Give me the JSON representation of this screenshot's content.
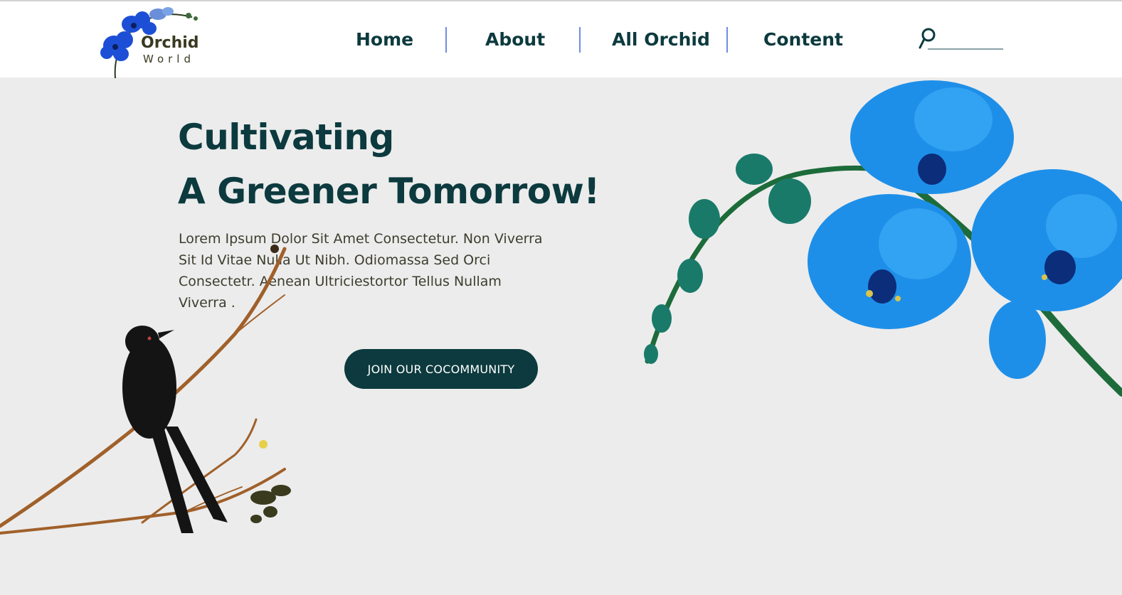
{
  "logo": {
    "title": "Orchid",
    "subtitle": "World"
  },
  "nav": {
    "items": [
      "Home",
      "About",
      "All Orchid",
      "Content"
    ]
  },
  "search": {
    "icon": "search-icon",
    "placeholder": ""
  },
  "hero": {
    "title_line1": "Cultivating",
    "title_line2": "A Greener Tomorrow!",
    "text_lines": [
      "Lorem Ipsum Dolor Sit Amet Consectetur. Non Viverra",
      "Sit Id Vitae        Nulla Ut Nibh. Odiomassa Sed Orci",
      "Consectetr.    Aenean Ultriciestortor Tellus Nullam",
      "Viverra ."
    ],
    "cta_label": "JOIN OUR COCOMMUNITY"
  },
  "colors": {
    "brand_dark": "#0c3a3e",
    "nav_separator": "#6f8de0",
    "background": "#ececec",
    "orchid_blue": "#1e8fe8"
  }
}
